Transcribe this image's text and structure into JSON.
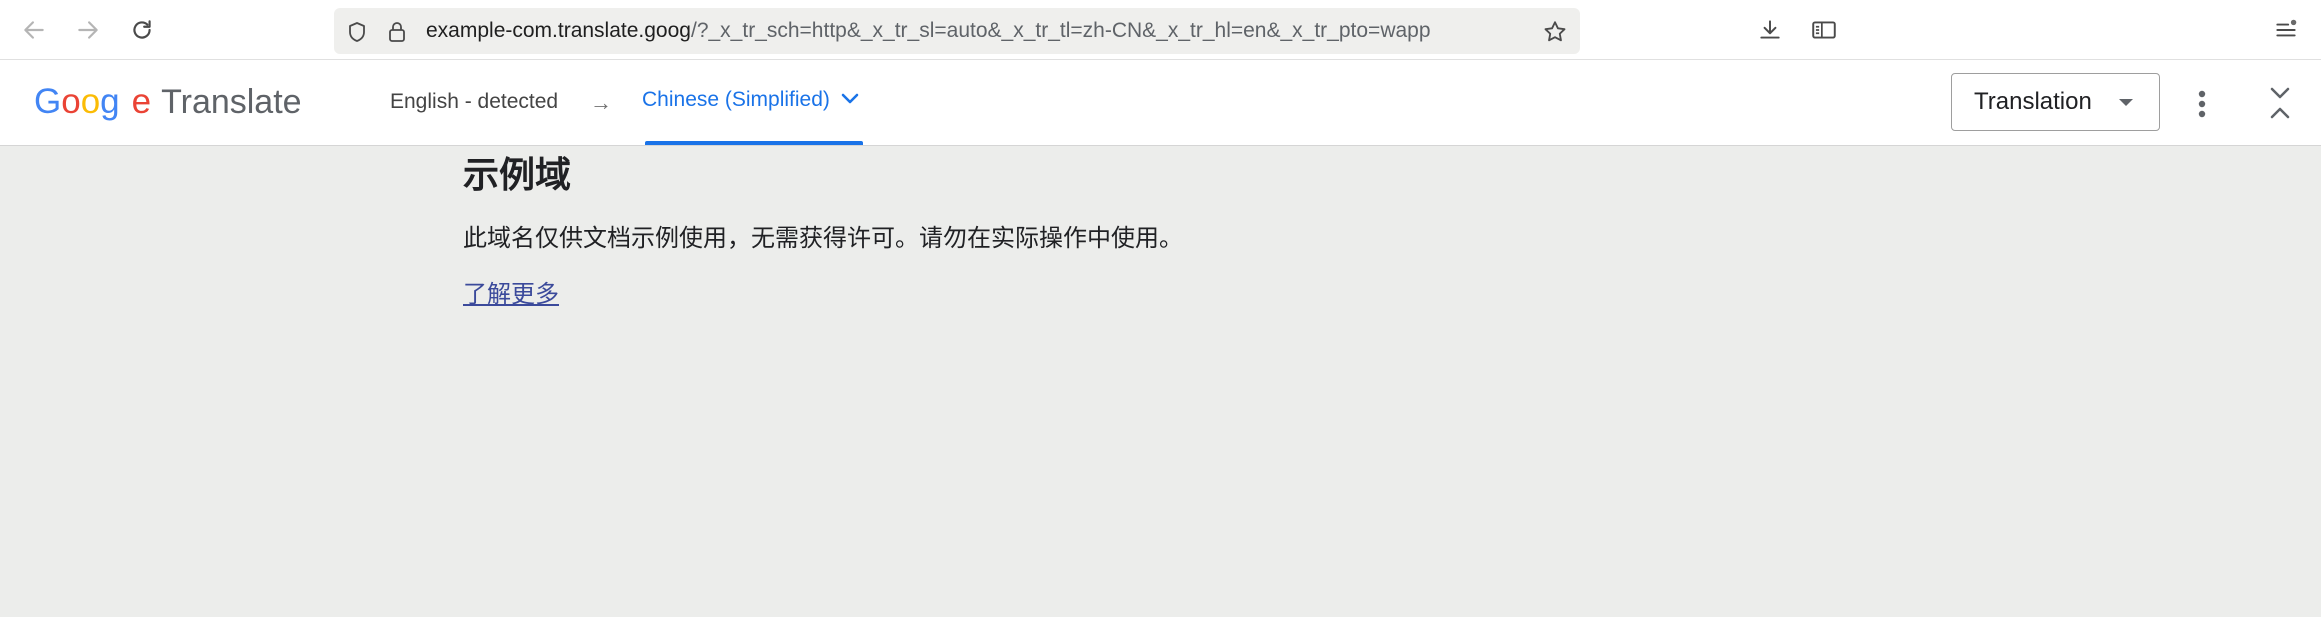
{
  "browser": {
    "url_domain": "example-com.translate.goog",
    "url_path": "/?_x_tr_sch=http&_x_tr_sl=auto&_x_tr_tl=zh-CN&_x_tr_hl=en&_x_tr_pto=wapp",
    "icons": [
      "back-arrow-icon",
      "forward-arrow-icon",
      "reload-icon",
      "shield-icon",
      "lock-icon",
      "star-icon",
      "download-icon",
      "sidebar-icon",
      "menu-icon"
    ]
  },
  "translate_bar": {
    "logo_letters": [
      "G",
      "o",
      "o",
      "g",
      "e"
    ],
    "logo_colors": [
      "#4285f4",
      "#ea4335",
      "#fbbc05",
      "#4285f4",
      "#ea4335"
    ],
    "logo_word": "Translate",
    "source_language": "English - detected",
    "arrow": "→",
    "target_language": "Chinese (Simplified)",
    "mode_label": "Translation",
    "accent_color": "#1a73e8"
  },
  "page": {
    "title": "示例域",
    "description": "此域名仅供文档示例使用，无需获得许可。请勿在实际操作中使用。",
    "link_label": "了解更多"
  }
}
